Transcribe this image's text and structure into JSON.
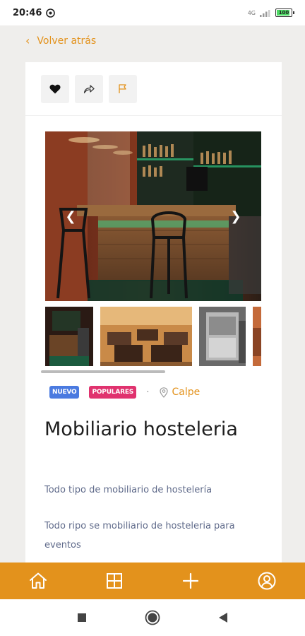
{
  "status_bar": {
    "time": "20:46",
    "battery": "100",
    "network": "4G"
  },
  "header": {
    "back_label": "Volver atrás"
  },
  "actions": {
    "icons": [
      "heart-icon",
      "share-icon",
      "flag-icon"
    ]
  },
  "gallery": {
    "main_image": "bar-counter-photo",
    "thumbnails": [
      "bar-counter-photo",
      "restaurant-interior-photo",
      "dishwasher-photo",
      "partial-photo"
    ]
  },
  "listing": {
    "badges": [
      "NUEVO",
      "POPULARES"
    ],
    "separator": "·",
    "location": "Calpe",
    "title": "Mobiliario hosteleria",
    "summary": "Todo tipo de mobiliario de hostelería",
    "description": "Todo ripo se mobiliario de hosteleria para eventos"
  },
  "bottom_nav": {
    "items": [
      "home-icon",
      "grid-icon",
      "plus-icon",
      "user-icon"
    ]
  },
  "colors": {
    "accent": "#e3921c",
    "badge_new": "#4a7ae0",
    "badge_popular": "#e0326e",
    "text_muted": "#5f6a8a"
  }
}
